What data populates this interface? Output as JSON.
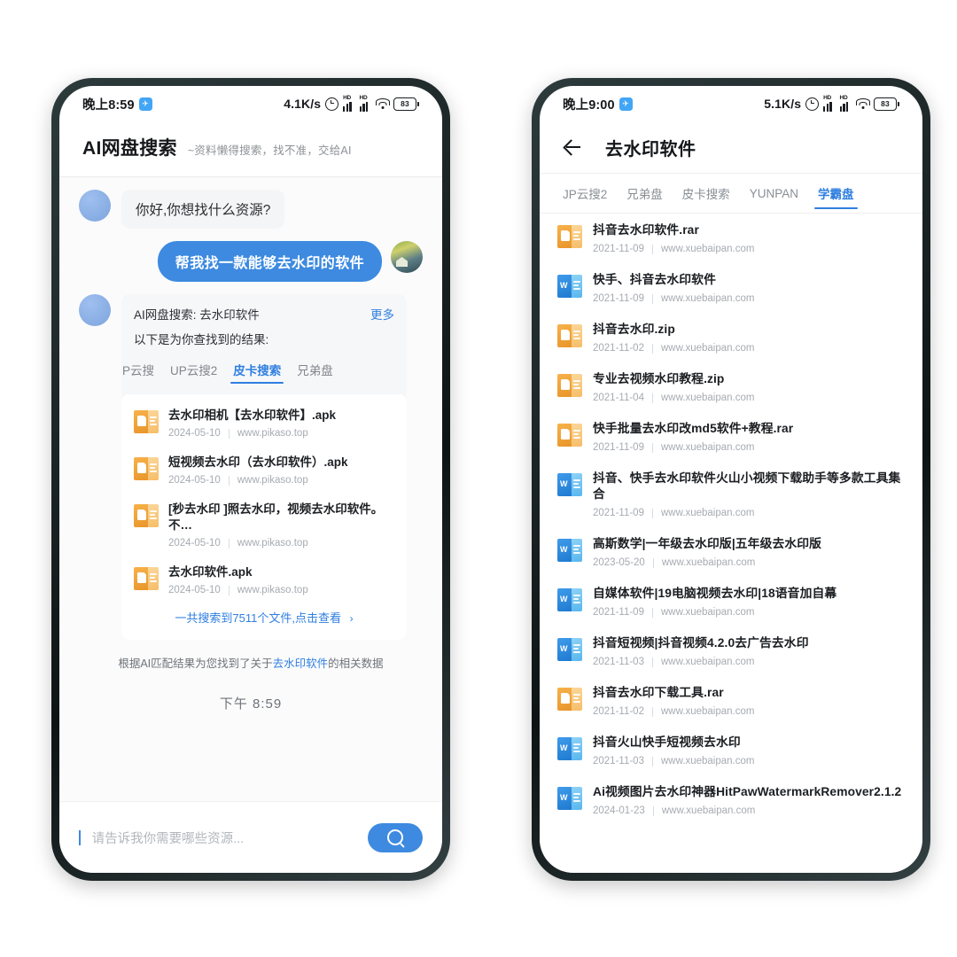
{
  "colors": {
    "accent": "#2f7fe0",
    "bubble_blue": "#3d8ae0",
    "archive_icon": "#e8952a",
    "word_icon": "#1f7ad0",
    "frame": "#1c2526"
  },
  "left_phone": {
    "status_bar": {
      "time": "晚上8:59",
      "app_badge": "✈",
      "speed": "4.1K/s",
      "signal_label_1": "HD",
      "signal_label_2": "HD",
      "battery": "83"
    },
    "header": {
      "title": "AI网盘搜索",
      "subtitle": "~资料懒得搜索，找不准，交给AI"
    },
    "messages": [
      {
        "from": "bot",
        "text": "你好,你想找什么资源?"
      },
      {
        "from": "user",
        "text": "帮我找一款能够去水印的软件"
      }
    ],
    "result_card": {
      "query_line": "AI网盘搜索: 去水印软件",
      "more_label": "更多",
      "sub_line": "以下是为你查找到的结果:",
      "tabs": [
        {
          "label": "P云搜",
          "active": false,
          "clipped": true
        },
        {
          "label": "UP云搜2",
          "active": false
        },
        {
          "label": "皮卡搜索",
          "active": true
        },
        {
          "label": "兄弟盘",
          "active": false
        }
      ],
      "files": [
        {
          "name": "去水印相机【去水印软件】.apk",
          "date": "2024-05-10",
          "site": "www.pikaso.top",
          "icon": "archive"
        },
        {
          "name": "短视频去水印（去水印软件）.apk",
          "date": "2024-05-10",
          "site": "www.pikaso.top",
          "icon": "archive"
        },
        {
          "name": "[秒去水印 ]照去水印，视频去水印软件。不…",
          "date": "2024-05-10",
          "site": "www.pikaso.top",
          "icon": "archive"
        },
        {
          "name": "去水印软件.apk",
          "date": "2024-05-10",
          "site": "www.pikaso.top",
          "icon": "archive"
        }
      ],
      "total_line": "一共搜索到7511个文件,点击查看",
      "chevron": "›"
    },
    "ai_note_prefix": "根据AI匹配结果为您找到了关于",
    "ai_note_keyword": "去水印软件",
    "ai_note_suffix": "的相关数据",
    "timestamp": "下午 8:59",
    "input": {
      "placeholder": "请告诉我你需要哪些资源...",
      "value": "",
      "search_icon": "search-icon"
    }
  },
  "right_phone": {
    "status_bar": {
      "time": "晚上9:00",
      "app_badge": "✈",
      "speed": "5.1K/s",
      "signal_label_1": "HD",
      "signal_label_2": "HD",
      "battery": "83"
    },
    "nav": {
      "back_icon": "back-arrow-icon",
      "title": "去水印软件"
    },
    "tabs": [
      {
        "label": "JP云搜2",
        "active": false
      },
      {
        "label": "兄弟盘",
        "active": false
      },
      {
        "label": "皮卡搜索",
        "active": false
      },
      {
        "label": "YUNPAN",
        "active": false
      },
      {
        "label": "学霸盘",
        "active": true
      }
    ],
    "files": [
      {
        "name": "抖音去水印软件.rar",
        "date": "2021-11-09",
        "site": "www.xuebaipan.com",
        "icon": "archive"
      },
      {
        "name": "快手、抖音去水印软件",
        "date": "2021-11-09",
        "site": "www.xuebaipan.com",
        "icon": "word"
      },
      {
        "name": "抖音去水印.zip",
        "date": "2021-11-02",
        "site": "www.xuebaipan.com",
        "icon": "archive"
      },
      {
        "name": "专业去视频水印教程.zip",
        "date": "2021-11-04",
        "site": "www.xuebaipan.com",
        "icon": "archive"
      },
      {
        "name": "快手批量去水印改md5软件+教程.rar",
        "date": "2021-11-09",
        "site": "www.xuebaipan.com",
        "icon": "archive"
      },
      {
        "name": "抖音、快手去水印软件火山小视频下载助手等多款工具集合",
        "date": "2021-11-09",
        "site": "www.xuebaipan.com",
        "icon": "word"
      },
      {
        "name": "高斯数学|一年级去水印版|五年级去水印版",
        "date": "2023-05-20",
        "site": "www.xuebaipan.com",
        "icon": "word"
      },
      {
        "name": "自媒体软件|19电脑视频去水印|18语音加自幕",
        "date": "2021-11-09",
        "site": "www.xuebaipan.com",
        "icon": "word"
      },
      {
        "name": "抖音短视频|抖音视频4.2.0去广告去水印",
        "date": "2021-11-03",
        "site": "www.xuebaipan.com",
        "icon": "word"
      },
      {
        "name": "抖音去水印下载工具.rar",
        "date": "2021-11-02",
        "site": "www.xuebaipan.com",
        "icon": "archive"
      },
      {
        "name": "抖音火山快手短视频去水印",
        "date": "2021-11-03",
        "site": "www.xuebaipan.com",
        "icon": "word"
      },
      {
        "name": "Ai视频图片去水印神器HitPawWatermarkRemover2.1.2",
        "date": "2024-01-23",
        "site": "www.xuebaipan.com",
        "icon": "word"
      }
    ]
  }
}
